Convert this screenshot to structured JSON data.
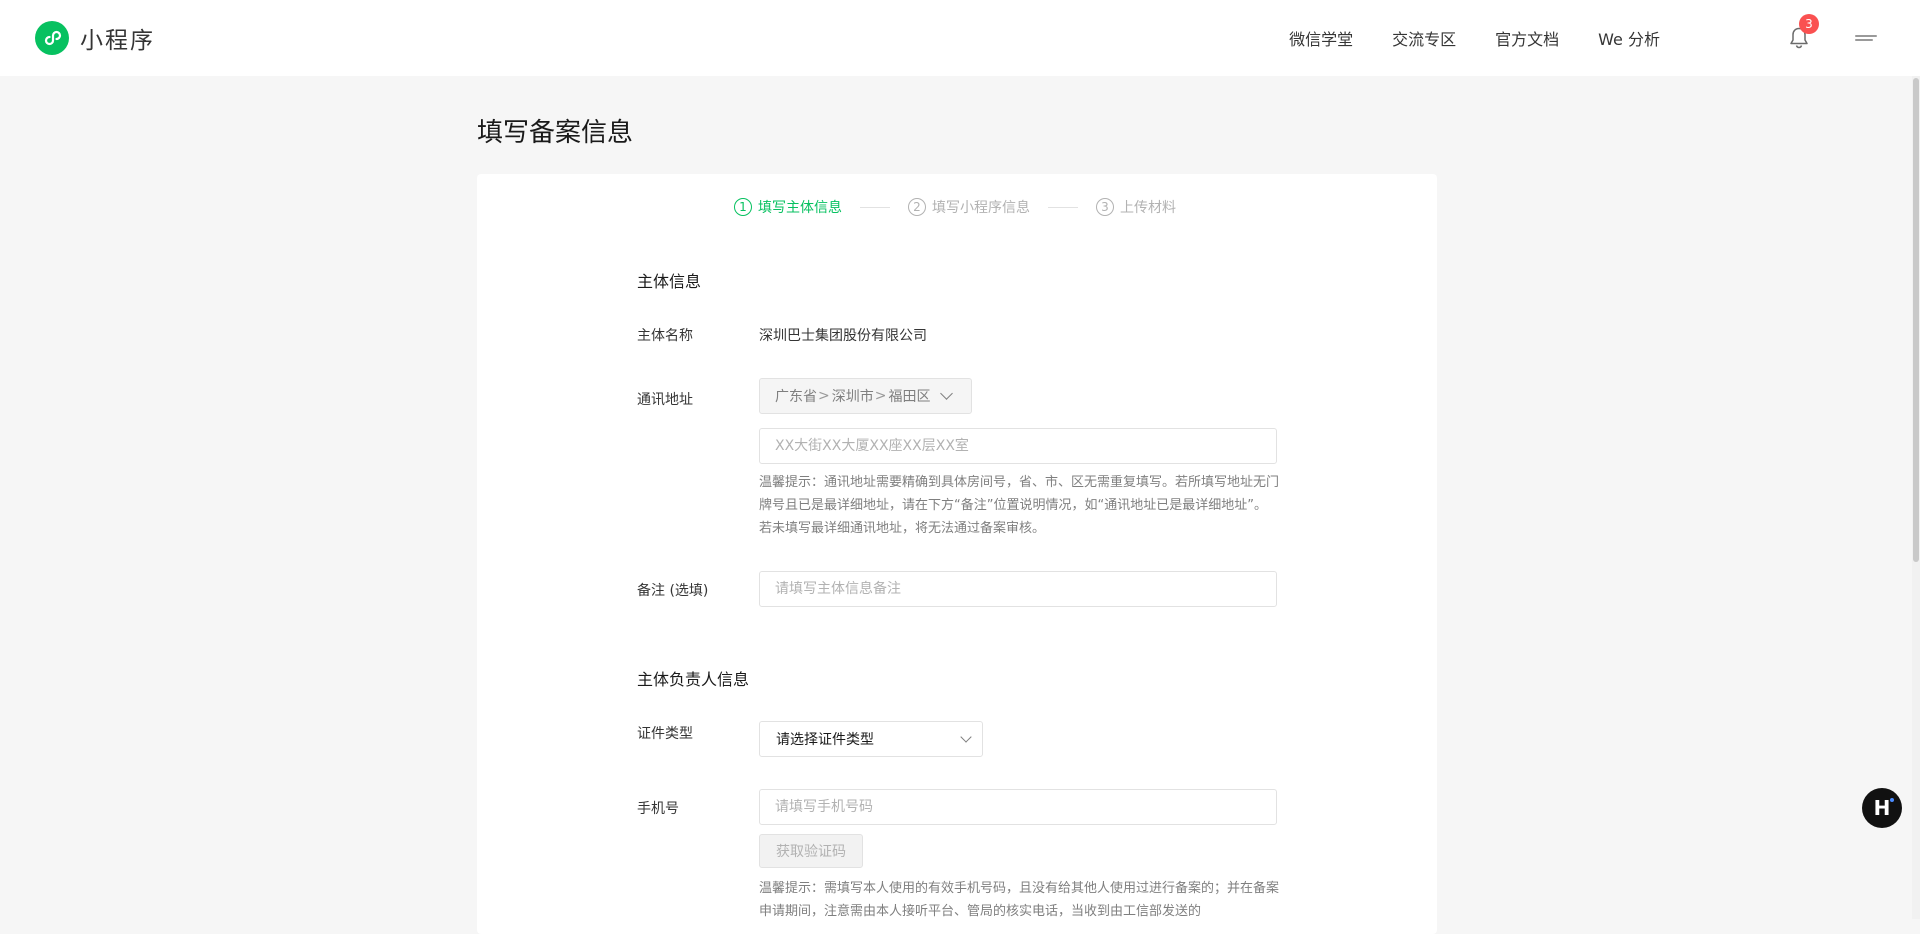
{
  "header": {
    "logo_text": "小程序",
    "nav": [
      "微信学堂",
      "交流专区",
      "官方文档",
      "We 分析"
    ],
    "notification_count": "3"
  },
  "page": {
    "title": "填写备案信息"
  },
  "steps": [
    {
      "num": "1",
      "label": "填写主体信息",
      "active": true
    },
    {
      "num": "2",
      "label": "填写小程序信息",
      "active": false
    },
    {
      "num": "3",
      "label": "上传材料",
      "active": false
    }
  ],
  "entity": {
    "section_title": "主体信息",
    "name_label": "主体名称",
    "name_value": "深圳巴士集团股份有限公司",
    "address_label": "通讯地址",
    "province": "广东省",
    "city": "深圳市",
    "district": "福田区",
    "address_placeholder": "XX大街XX大厦XX座XX层XX室",
    "address_tip": "温馨提示：通讯地址需要精确到具体房间号，省、市、区无需重复填写。若所填写地址无门牌号且已是最详细地址，请在下方“备注”位置说明情况，如“通讯地址已是最详细地址”。若未填写最详细通讯地址，将无法通过备案审核。",
    "remark_label": "备注 (选填)",
    "remark_placeholder": "请填写主体信息备注"
  },
  "principal": {
    "section_title": "主体负责人信息",
    "id_type_label": "证件类型",
    "id_type_value": "请选择证件类型",
    "phone_label": "手机号",
    "phone_placeholder": "请填写手机号码",
    "get_code_label": "获取验证码",
    "phone_tip": "温馨提示：需填写本人使用的有效手机号码，且没有给其他人使用过进行备案的；并在备案申请期间，注意需由本人接听平台、管局的核实电话，当收到由工信部发送的"
  },
  "colors": {
    "accent": "#07c160",
    "badge": "#fa5151"
  }
}
